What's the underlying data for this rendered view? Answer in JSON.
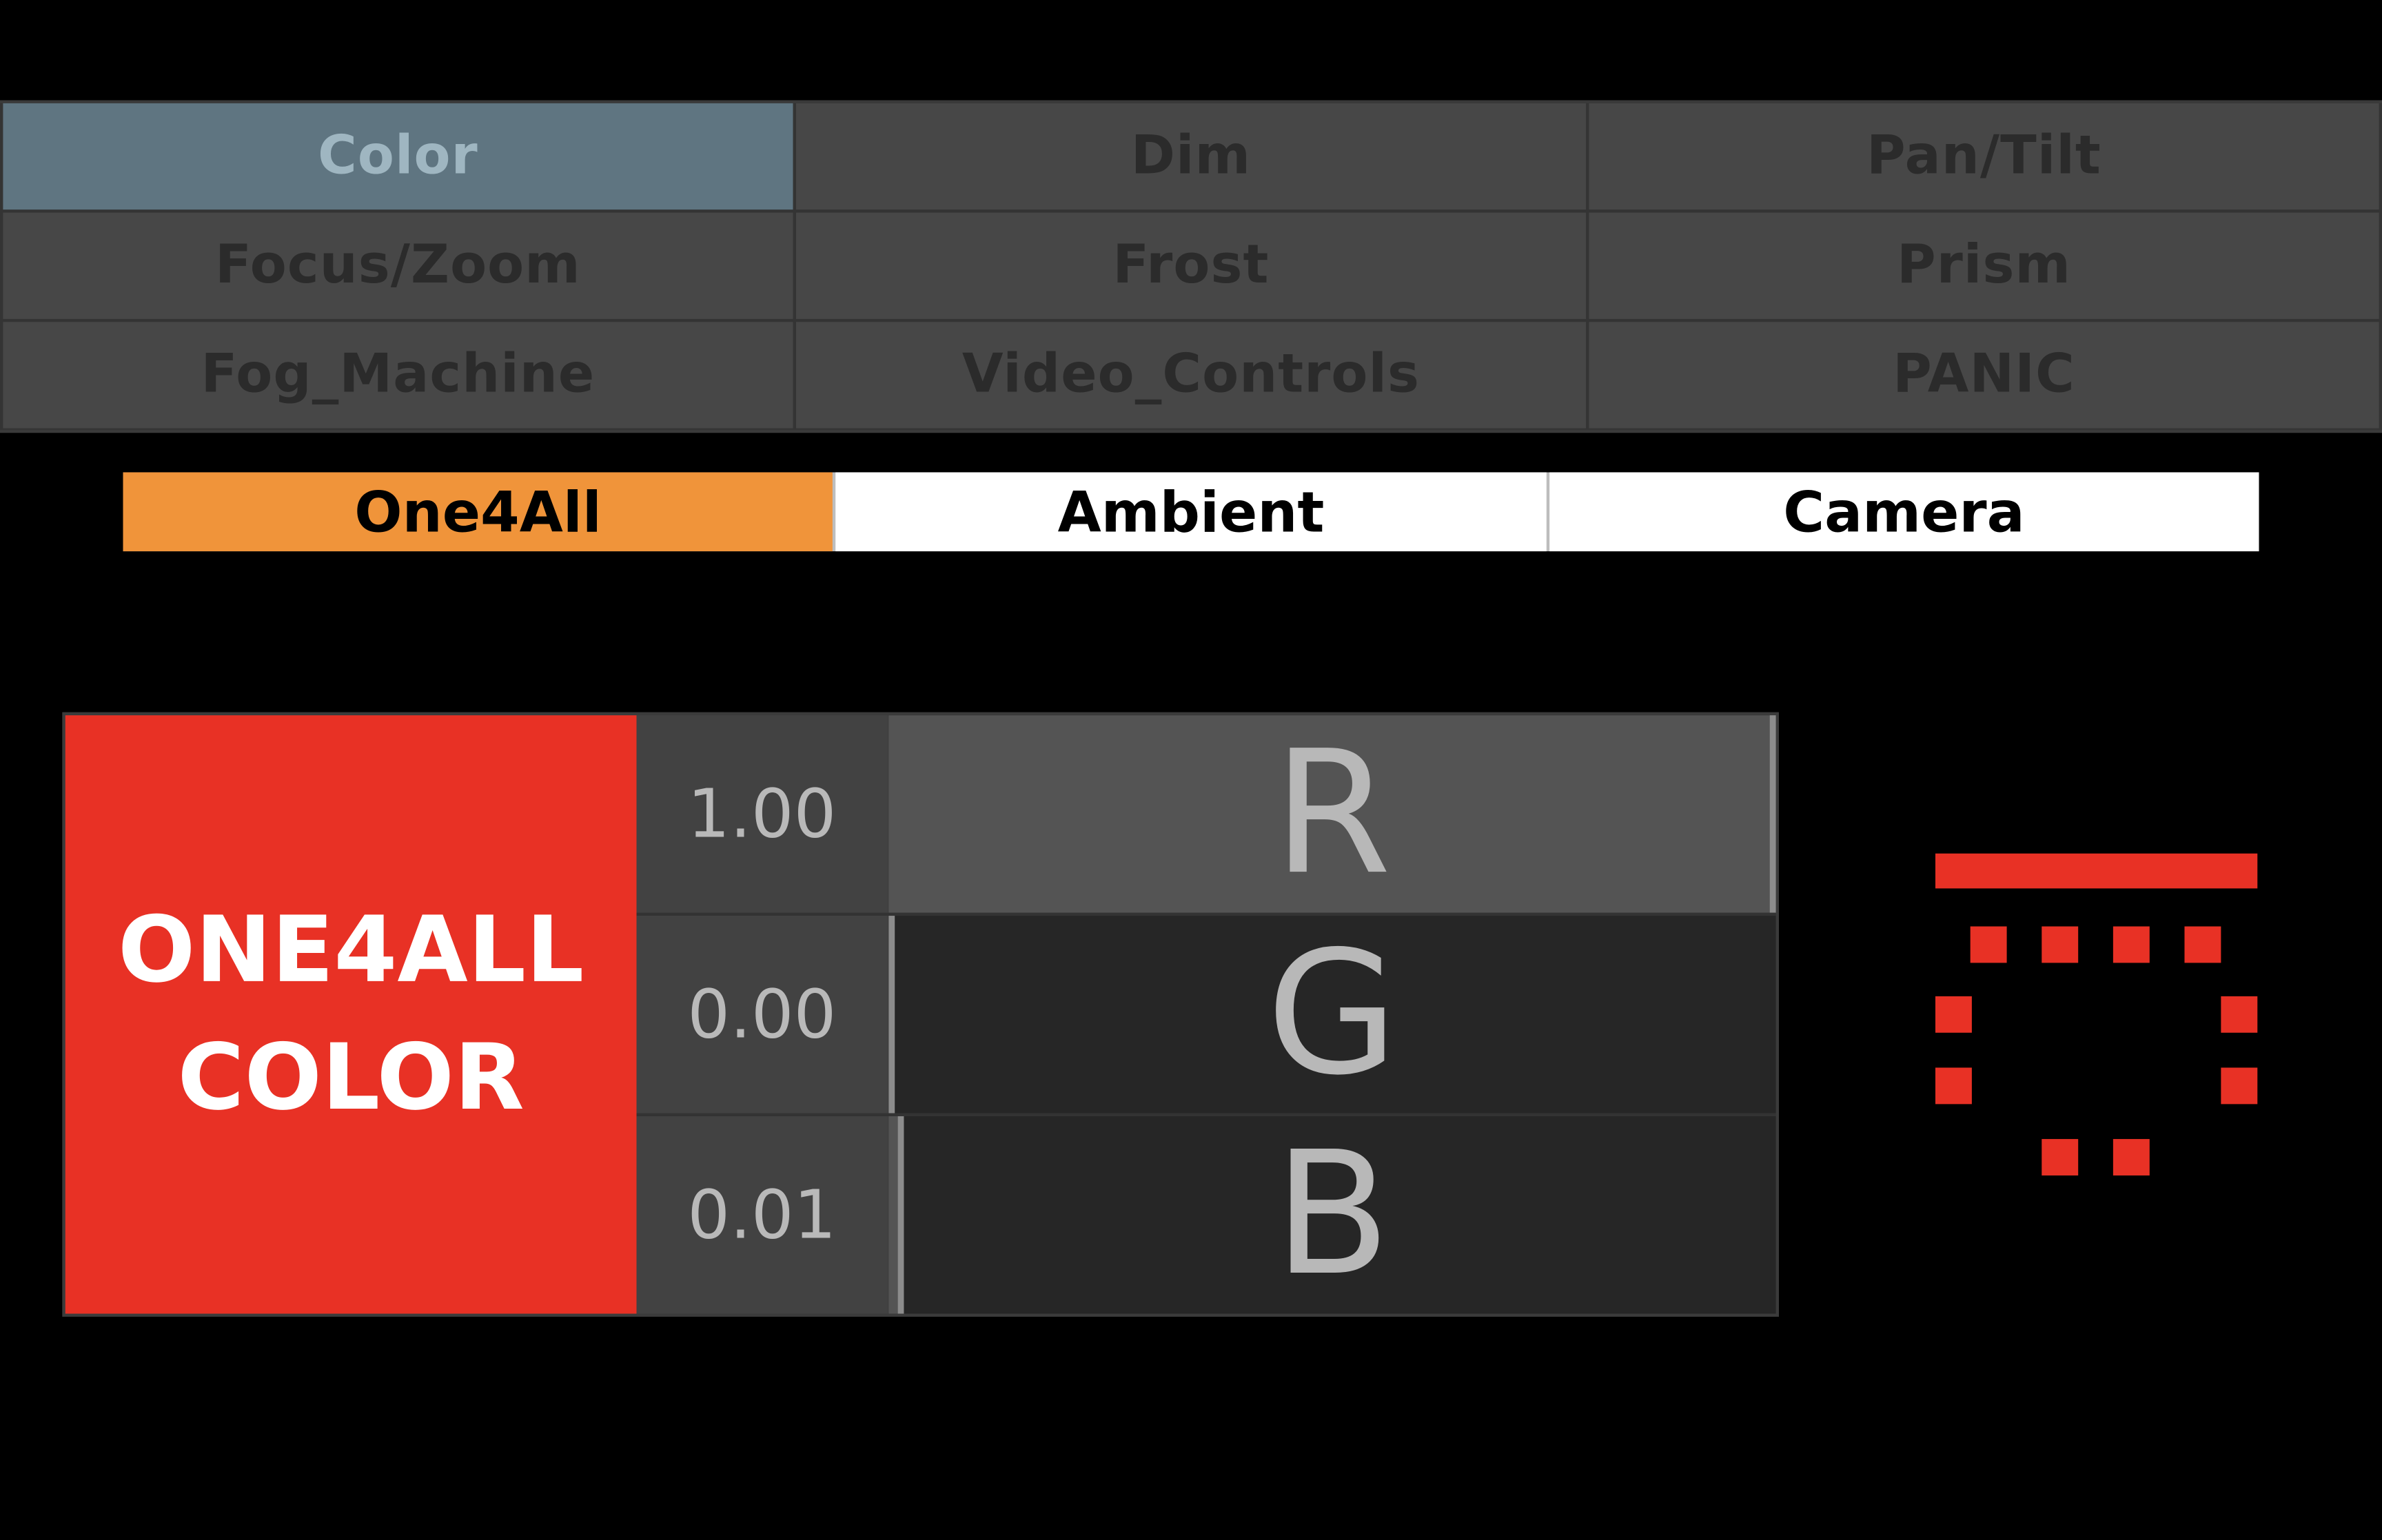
{
  "categories": [
    {
      "label": "Color",
      "active": true
    },
    {
      "label": "Dim",
      "active": false
    },
    {
      "label": "Pan/Tilt",
      "active": false
    },
    {
      "label": "Focus/Zoom",
      "active": false
    },
    {
      "label": "Frost",
      "active": false
    },
    {
      "label": "Prism",
      "active": false
    },
    {
      "label": "Fog_Machine",
      "active": false
    },
    {
      "label": "Video_Controls",
      "active": false
    },
    {
      "label": "PANIC",
      "active": false
    }
  ],
  "presets": [
    {
      "label": "One4All",
      "active": true
    },
    {
      "label": "Ambient",
      "active": false
    },
    {
      "label": "Camera",
      "active": false
    }
  ],
  "color_block": {
    "line1": "ONE4ALL",
    "line2": "COLOR",
    "color": "#e83125"
  },
  "channels": [
    {
      "letter": "R",
      "value_text": "1.00",
      "level": 1.0
    },
    {
      "letter": "G",
      "value_text": "0.00",
      "level": 0.0
    },
    {
      "letter": "B",
      "value_text": "0.01",
      "level": 0.01
    }
  ],
  "status_icon": {
    "name": "loading-grid-icon",
    "color": "#e83125"
  },
  "colors": {
    "active_category": "#5f7581",
    "active_preset": "#f0943a",
    "accent_red": "#e83125"
  }
}
